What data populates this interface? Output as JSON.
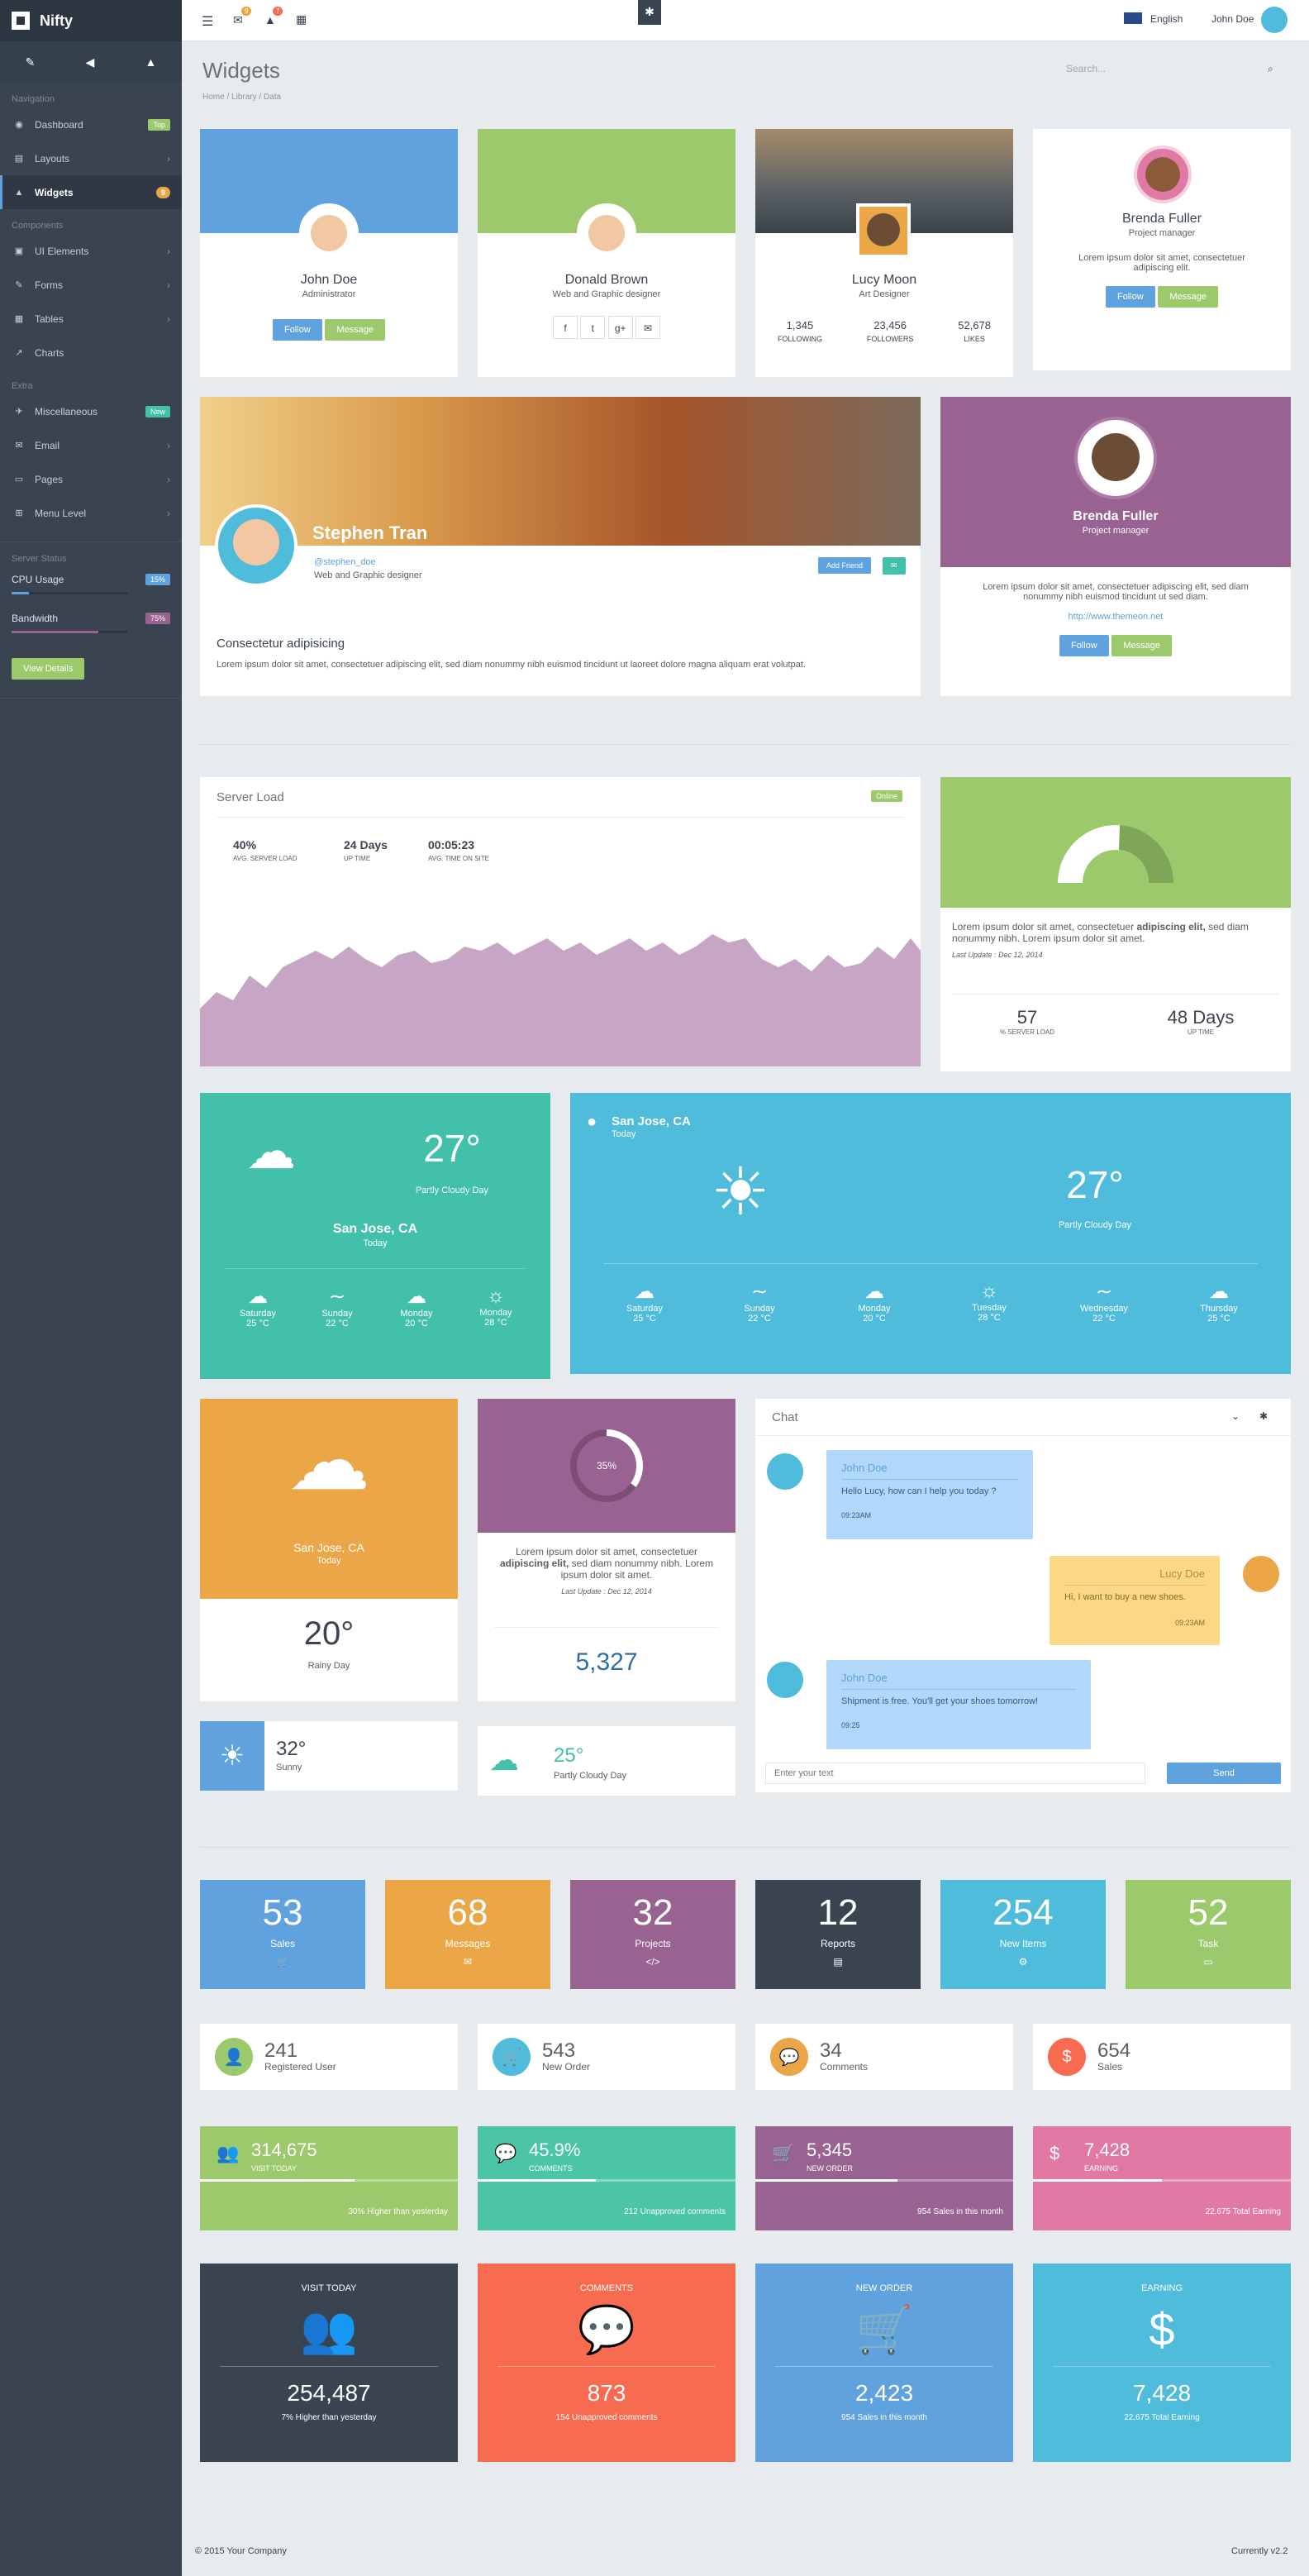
{
  "app": {
    "brand": "Nifty"
  },
  "sidebar": {
    "cat_navigation": "Navigation",
    "dashboard": "Dashboard",
    "dashboard_badge": "Top",
    "layouts": "Layouts",
    "widgets": "Widgets",
    "widgets_badge": "9",
    "cat_components": "Components",
    "ui": "UI Elements",
    "forms": "Forms",
    "tables": "Tables",
    "charts": "Charts",
    "cat_extra": "Extra",
    "misc": "Miscellaneous",
    "misc_badge": "New",
    "email": "Email",
    "pages": "Pages",
    "menu": "Menu Level",
    "cat_status": "Server Status",
    "cpu": "CPU Usage",
    "cpu_val": "15%",
    "bandwidth": "Bandwidth",
    "bw_val": "75%",
    "cpu_level": 0.15,
    "bw_level": 0.75,
    "details": "View Details"
  },
  "header": {
    "lang": "English",
    "user": "John Doe",
    "mail_count": "9",
    "bell_count": "7"
  },
  "page": {
    "title": "Widgets",
    "crumb1": "Home",
    "crumb2": "Library",
    "crumb3": "Data",
    "search": "Search..."
  },
  "profiles": {
    "p1": {
      "name": "John Doe",
      "role": "Administrator",
      "follow": "Follow",
      "message": "Message"
    },
    "p2": {
      "name": "Donald Brown",
      "role": "Web and Graphic designer"
    },
    "p3": {
      "name": "Lucy Moon",
      "role": "Art Designer",
      "n1": "1,345",
      "l1": "FOLLOWING",
      "n2": "23,456",
      "l2": "FOLLOWERS",
      "n3": "52,678",
      "l3": "LIKES"
    },
    "p4": {
      "name": "Brenda Fuller",
      "role": "Project manager",
      "text": "Lorem ipsum dolor sit amet, consectetuer adipiscing elit.",
      "follow": "Follow",
      "message": "Message"
    }
  },
  "cover": {
    "name": "Stephen Tran",
    "handle": "@stephen_doe",
    "role": "Web and Graphic designer",
    "add": "Add Friend",
    "heading": "Consectetur adipisicing",
    "text": "Lorem ipsum dolor sit amet, consectetuer adipiscing elit, sed diam nonummy nibh euismod tincidunt ut laoreet dolore magna aliquam erat volutpat."
  },
  "brenda2": {
    "name": "Brenda Fuller",
    "role": "Project manager",
    "text": "Lorem ipsum dolor sit amet, consectetuer adipiscing elit, sed diam nonummy nibh euismod tincidunt ut sed diam.",
    "link": "http://www.themeon.net",
    "follow": "Follow",
    "message": "Message"
  },
  "server": {
    "title": "Server Load",
    "status": "Online",
    "s1": "40%",
    "l1": "AVG. SERVER LOAD",
    "s2": "24 Days",
    "l2": "UP TIME",
    "s3": "00:05:23",
    "l3": "AVG. TIME ON SITE"
  },
  "gauge": {
    "text1": "Lorem ipsum dolor sit amet, consectetuer ",
    "text_bold": "adipiscing elit,",
    "text2": " sed diam nonummy nibh. Lorem ipsum dolor sit amet.",
    "update": "Last Update : Dec 12, 2014",
    "v1": "57",
    "l1": "% SERVER LOAD",
    "v2": "48 Days",
    "l2": "UP TIME"
  },
  "weather1": {
    "temp": "27°",
    "cond": "Partly Cloudy Day",
    "city": "San Jose, CA",
    "day": "Today",
    "days": [
      {
        "d": "Saturday",
        "t": "25 °C"
      },
      {
        "d": "Sunday",
        "t": "22 °C"
      },
      {
        "d": "Monday",
        "t": "20 °C"
      },
      {
        "d": "Monday",
        "t": "28 °C"
      }
    ]
  },
  "weather2": {
    "city": "San Jose, CA",
    "day": "Today",
    "temp": "27°",
    "cond": "Partly Cloudy Day",
    "days": [
      {
        "d": "Saturday",
        "t": "25 °C"
      },
      {
        "d": "Sunday",
        "t": "22 °C"
      },
      {
        "d": "Monday",
        "t": "20 °C"
      },
      {
        "d": "Tuesday",
        "t": "28 °C"
      },
      {
        "d": "Wednesday",
        "t": "22 °C"
      },
      {
        "d": "Thursday",
        "t": "25 °C"
      }
    ]
  },
  "rainy": {
    "city": "San Jose, CA",
    "day": "Today",
    "temp": "20°",
    "cond": "Rainy Day"
  },
  "donut": {
    "pct": "35%",
    "text1": "Lorem ipsum dolor sit amet, consectetuer ",
    "bold": "adipiscing elit,",
    "text2": " sed diam nonummy nibh. Lorem ipsum dolor sit amet.",
    "update": "Last Update : Dec 12, 2014",
    "value": "5,327"
  },
  "small_w": {
    "t1": "32°",
    "c1": "Sunny",
    "t2": "25°",
    "c2": "Partly Cloudy Day"
  },
  "chat": {
    "title": "Chat",
    "m1": {
      "name": "John Doe",
      "text": "Hello Lucy, how can I help you today ?",
      "time": "09:23AM"
    },
    "m2": {
      "name": "Lucy Doe",
      "text": "Hi, I want to buy a new shoes.",
      "time": "09:23AM"
    },
    "m3": {
      "name": "John Doe",
      "text": "Shipment is free. You'll get your shoes tomorrow!",
      "time": "09:25"
    },
    "placeholder": "Enter your text",
    "send": "Send"
  },
  "tiles": [
    {
      "n": "53",
      "l": "Sales",
      "c": "#5fa2dd"
    },
    {
      "n": "68",
      "l": "Messages",
      "c": "#eaa647"
    },
    {
      "n": "32",
      "l": "Projects",
      "c": "#986291"
    },
    {
      "n": "12",
      "l": "Reports",
      "c": "#3a4451"
    },
    {
      "n": "254",
      "l": "New Items",
      "c": "#4ebcda"
    },
    {
      "n": "52",
      "l": "Task",
      "c": "#9cc96b"
    }
  ],
  "minis": [
    {
      "n": "241",
      "l": "Registered User",
      "c": "#9cc96b"
    },
    {
      "n": "543",
      "l": "New Order",
      "c": "#4ebcda"
    },
    {
      "n": "34",
      "l": "Comments",
      "c": "#eaa647"
    },
    {
      "n": "654",
      "l": "Sales",
      "c": "#f76c51"
    }
  ],
  "progs": [
    {
      "n": "314,675",
      "l": "VISIT TODAY",
      "f": "30% Higher than yesterday",
      "c": "#9cc96b",
      "level": 0.6
    },
    {
      "n": "45.9%",
      "l": "COMMENTS",
      "f": "212 Unapproved comments",
      "c": "#4bc5a6",
      "level": 0.459
    },
    {
      "n": "5,345",
      "l": "NEW ORDER",
      "f": "954 Sales in this month",
      "c": "#986291",
      "level": 0.55
    },
    {
      "n": "7,428",
      "l": "EARNING",
      "f": "22,675 Total Earning",
      "c": "#e07aa4",
      "level": 0.5
    }
  ],
  "bigs": [
    {
      "t": "VISIT TODAY",
      "n": "254,487",
      "f": "7% Higher than yesterday",
      "c": "#3a4451"
    },
    {
      "t": "COMMENTS",
      "n": "873",
      "f": "154 Unapproved comments",
      "c": "#f76c51"
    },
    {
      "t": "NEW ORDER",
      "n": "2,423",
      "f": "954 Sales in this month",
      "c": "#5fa2dd"
    },
    {
      "t": "EARNING",
      "n": "7,428",
      "f": "22,675 Total Earning",
      "c": "#4ebcda"
    }
  ],
  "footer": {
    "left": "© 2015 Your Company",
    "right": "Currently v2.2"
  }
}
